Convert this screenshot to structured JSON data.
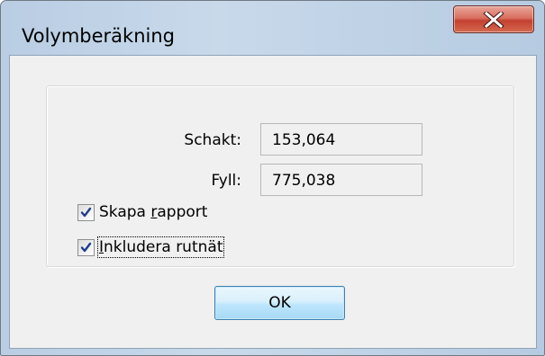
{
  "window": {
    "title": "Volymberäkning",
    "close_icon": "close-icon"
  },
  "fields": {
    "schakt": {
      "label": "Schakt:",
      "value": "153,064"
    },
    "fyll": {
      "label": "Fyll:",
      "value": "775,038"
    }
  },
  "options": {
    "skapa_rapport": {
      "label_pre": "Skapa ",
      "label_accel": "r",
      "label_post": "apport",
      "checked": true
    },
    "inkludera_rutnat": {
      "label_accel": "I",
      "label_post": "nkludera rutnät",
      "checked": true
    }
  },
  "buttons": {
    "ok_label": "OK"
  },
  "colors": {
    "close_button": "#c44030",
    "ok_border": "#3c7fb1",
    "frame": "#c8d9ea",
    "client": "#f0f0f0"
  }
}
